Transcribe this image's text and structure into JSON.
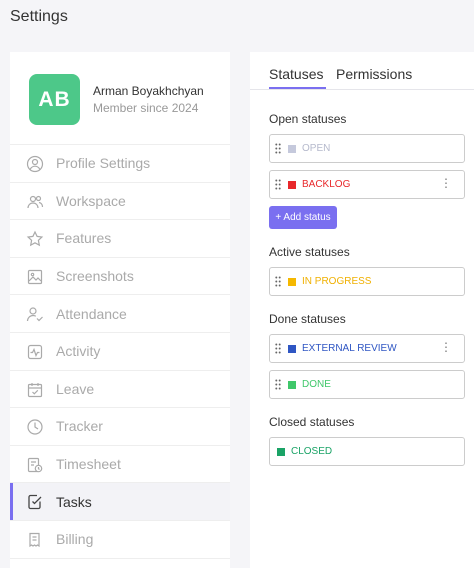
{
  "page": {
    "title": "Settings"
  },
  "profile": {
    "initials": "AB",
    "name": "Arman Boyakhchyan",
    "member_since": "Member since 2024",
    "avatar_color": "#4dc889"
  },
  "nav": {
    "items": [
      {
        "label": "Profile Settings",
        "icon": "user-circle-icon",
        "active": false
      },
      {
        "label": "Workspace",
        "icon": "users-icon",
        "active": false
      },
      {
        "label": "Features",
        "icon": "star-icon",
        "active": false
      },
      {
        "label": "Screenshots",
        "icon": "image-icon",
        "active": false
      },
      {
        "label": "Attendance",
        "icon": "user-check-icon",
        "active": false
      },
      {
        "label": "Activity",
        "icon": "activity-icon",
        "active": false
      },
      {
        "label": "Leave",
        "icon": "calendar-check-icon",
        "active": false
      },
      {
        "label": "Tracker",
        "icon": "clock-icon",
        "active": false
      },
      {
        "label": "Timesheet",
        "icon": "timesheet-icon",
        "active": false
      },
      {
        "label": "Tasks",
        "icon": "task-check-icon",
        "active": true
      },
      {
        "label": "Billing",
        "icon": "billing-icon",
        "active": false
      }
    ]
  },
  "tabs": [
    {
      "label": "Statuses",
      "active": true
    },
    {
      "label": "Permissions",
      "active": false
    }
  ],
  "accent_color": "#7a6ff0",
  "sections": {
    "open": {
      "label": "Open statuses"
    },
    "active": {
      "label": "Active statuses"
    },
    "done": {
      "label": "Done statuses"
    },
    "closed": {
      "label": "Closed statuses"
    }
  },
  "statuses": {
    "open": [
      {
        "name": "OPEN",
        "color": "#c5c9dc"
      },
      {
        "name": "BACKLOG",
        "color": "#e8282b"
      }
    ],
    "active": [
      {
        "name": "IN PROGRESS",
        "color": "#f5b800"
      }
    ],
    "done": [
      {
        "name": "EXTERNAL REVIEW",
        "color": "#2f56c3"
      },
      {
        "name": "DONE",
        "color": "#3fc76a"
      }
    ],
    "closed": [
      {
        "name": "CLOSED",
        "color": "#1aa366"
      }
    ]
  },
  "add_status_label": "+ Add status",
  "more_icon": "more-vertical-icon",
  "grip_icon": "drag-handle-icon"
}
